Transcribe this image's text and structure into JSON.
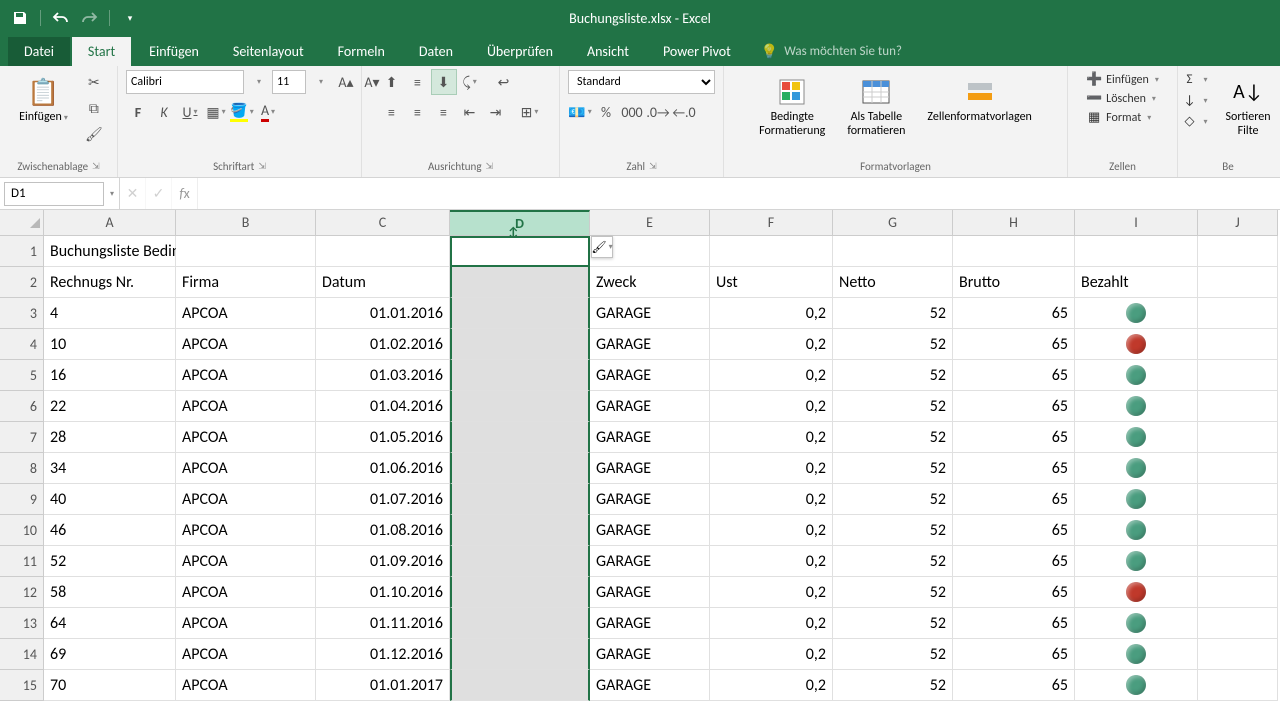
{
  "title": "Buchungsliste.xlsx - Excel",
  "tabs": {
    "file": "Datei",
    "home": "Start",
    "insert": "Einfügen",
    "pagelayout": "Seitenlayout",
    "formulas": "Formeln",
    "data": "Daten",
    "review": "Überprüfen",
    "view": "Ansicht",
    "powerpivot": "Power Pivot"
  },
  "tellme": {
    "placeholder": "Was möchten Sie tun?"
  },
  "ribbon": {
    "clipboard": {
      "paste": "Einfügen",
      "label": "Zwischenablage"
    },
    "font": {
      "name": "Calibri",
      "size": "11",
      "label": "Schriftart"
    },
    "alignment": {
      "label": "Ausrichtung"
    },
    "number": {
      "format": "Standard",
      "label": "Zahl"
    },
    "styles": {
      "cond": "Bedingte\nFormatierung",
      "table": "Als Tabelle\nformatieren",
      "cell": "Zellenformatvorlagen",
      "label": "Formatvorlagen"
    },
    "cells": {
      "insert": "Einfügen",
      "delete": "Löschen",
      "format": "Format",
      "label": "Zellen"
    },
    "editing": {
      "sort": "Sortieren\nFilte",
      "label": "Be"
    }
  },
  "namebox": "D1",
  "columns": [
    "A",
    "B",
    "C",
    "D",
    "E",
    "F",
    "G",
    "H",
    "I",
    "J"
  ],
  "selectedColumn": "D",
  "headerRow": {
    "title": "Buchungsliste Bedingte Formatierung",
    "cols": [
      "Rechnugs Nr.",
      "Firma",
      "Datum",
      "",
      "Zweck",
      "Ust",
      "Netto",
      "Brutto",
      "Bezahlt"
    ]
  },
  "rows": [
    {
      "n": "4",
      "firma": "APCOA",
      "datum": "01.01.2016",
      "zweck": "GARAGE",
      "ust": "0,2",
      "netto": "52",
      "brutto": "65",
      "paid": "green"
    },
    {
      "n": "10",
      "firma": "APCOA",
      "datum": "01.02.2016",
      "zweck": "GARAGE",
      "ust": "0,2",
      "netto": "52",
      "brutto": "65",
      "paid": "red"
    },
    {
      "n": "16",
      "firma": "APCOA",
      "datum": "01.03.2016",
      "zweck": "GARAGE",
      "ust": "0,2",
      "netto": "52",
      "brutto": "65",
      "paid": "green"
    },
    {
      "n": "22",
      "firma": "APCOA",
      "datum": "01.04.2016",
      "zweck": "GARAGE",
      "ust": "0,2",
      "netto": "52",
      "brutto": "65",
      "paid": "green"
    },
    {
      "n": "28",
      "firma": "APCOA",
      "datum": "01.05.2016",
      "zweck": "GARAGE",
      "ust": "0,2",
      "netto": "52",
      "brutto": "65",
      "paid": "green"
    },
    {
      "n": "34",
      "firma": "APCOA",
      "datum": "01.06.2016",
      "zweck": "GARAGE",
      "ust": "0,2",
      "netto": "52",
      "brutto": "65",
      "paid": "green"
    },
    {
      "n": "40",
      "firma": "APCOA",
      "datum": "01.07.2016",
      "zweck": "GARAGE",
      "ust": "0,2",
      "netto": "52",
      "brutto": "65",
      "paid": "green"
    },
    {
      "n": "46",
      "firma": "APCOA",
      "datum": "01.08.2016",
      "zweck": "GARAGE",
      "ust": "0,2",
      "netto": "52",
      "brutto": "65",
      "paid": "green"
    },
    {
      "n": "52",
      "firma": "APCOA",
      "datum": "01.09.2016",
      "zweck": "GARAGE",
      "ust": "0,2",
      "netto": "52",
      "brutto": "65",
      "paid": "green"
    },
    {
      "n": "58",
      "firma": "APCOA",
      "datum": "01.10.2016",
      "zweck": "GARAGE",
      "ust": "0,2",
      "netto": "52",
      "brutto": "65",
      "paid": "red"
    },
    {
      "n": "64",
      "firma": "APCOA",
      "datum": "01.11.2016",
      "zweck": "GARAGE",
      "ust": "0,2",
      "netto": "52",
      "brutto": "65",
      "paid": "green"
    },
    {
      "n": "69",
      "firma": "APCOA",
      "datum": "01.12.2016",
      "zweck": "GARAGE",
      "ust": "0,2",
      "netto": "52",
      "brutto": "65",
      "paid": "green"
    },
    {
      "n": "70",
      "firma": "APCOA",
      "datum": "01.01.2017",
      "zweck": "GARAGE",
      "ust": "0,2",
      "netto": "52",
      "brutto": "65",
      "paid": "green"
    }
  ]
}
